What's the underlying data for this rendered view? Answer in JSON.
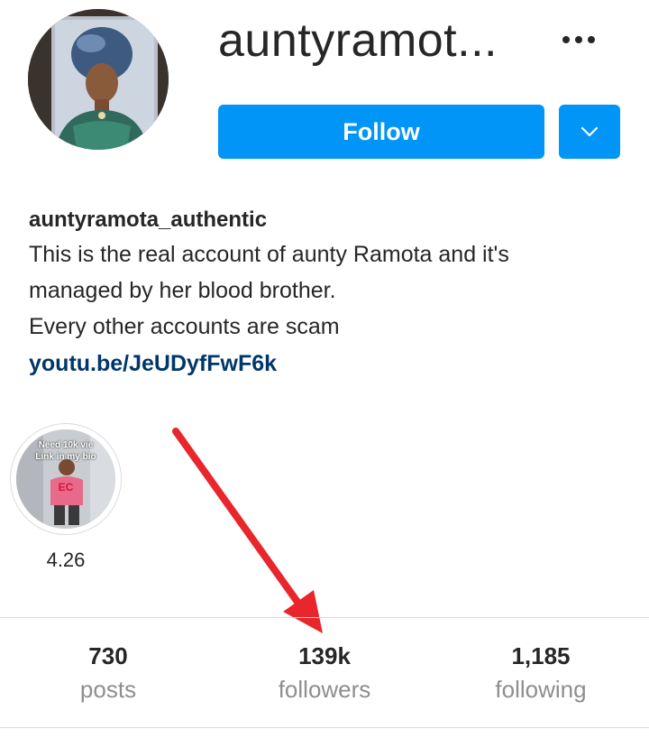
{
  "profile": {
    "username_display": "auntyramot...",
    "bio_name": "auntyramota_authentic",
    "bio_lines": [
      "This is the real account of aunty Ramota and it's",
      "managed by her blood brother.",
      "Every other accounts are scam"
    ],
    "bio_link": "youtu.be/JeUDyfFwF6k"
  },
  "actions": {
    "follow_label": "Follow",
    "more_icon": "more-horizontal-icon",
    "dropdown_icon": "chevron-down-icon"
  },
  "highlight": {
    "label": "4.26",
    "overlay_top": "Need 10k vie",
    "overlay_sub": "Link in my bio",
    "shirt_text": "EC"
  },
  "stats": [
    {
      "value": "730",
      "label": "posts"
    },
    {
      "value": "139k",
      "label": "followers"
    },
    {
      "value": "1,185",
      "label": "following"
    }
  ],
  "colors": {
    "accent": "#0095f6",
    "link": "#00376b",
    "annotation_arrow": "#e8262c"
  }
}
